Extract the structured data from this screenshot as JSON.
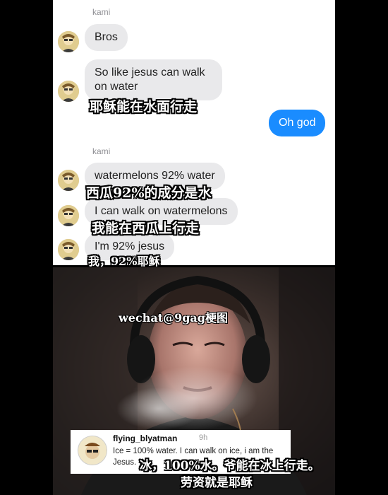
{
  "chat": {
    "sender_name_1": "kami",
    "sender_name_2": "kami",
    "messages": [
      {
        "text": "Bros",
        "from": "kami"
      },
      {
        "text": "So like jesus can walk on water",
        "from": "kami"
      },
      {
        "text": "Oh god",
        "from": "me"
      },
      {
        "text": "watermelons 92% water",
        "from": "kami"
      },
      {
        "text": "I can walk on watermelons",
        "from": "kami"
      },
      {
        "text": "I'm 92% jesus",
        "from": "kami"
      }
    ],
    "subtitles": [
      "耶稣能在水面行走",
      "西瓜92%的成分是水",
      "我能在西瓜上行走",
      "我，92%耶稣"
    ],
    "colors": {
      "sent_bubble": "#1a8cff",
      "received_bubble": "#e9e9eb"
    }
  },
  "photo": {
    "watermark": "wechat@9gag梗图",
    "comment": {
      "username": "flying_blyatman",
      "time": "9h",
      "text": "Ice = 100% water. I can walk on ice, i am the Jesus."
    },
    "subtitles": [
      "冰，100%水。爷能在冰上行走。",
      "劳资就是耶稣"
    ]
  }
}
